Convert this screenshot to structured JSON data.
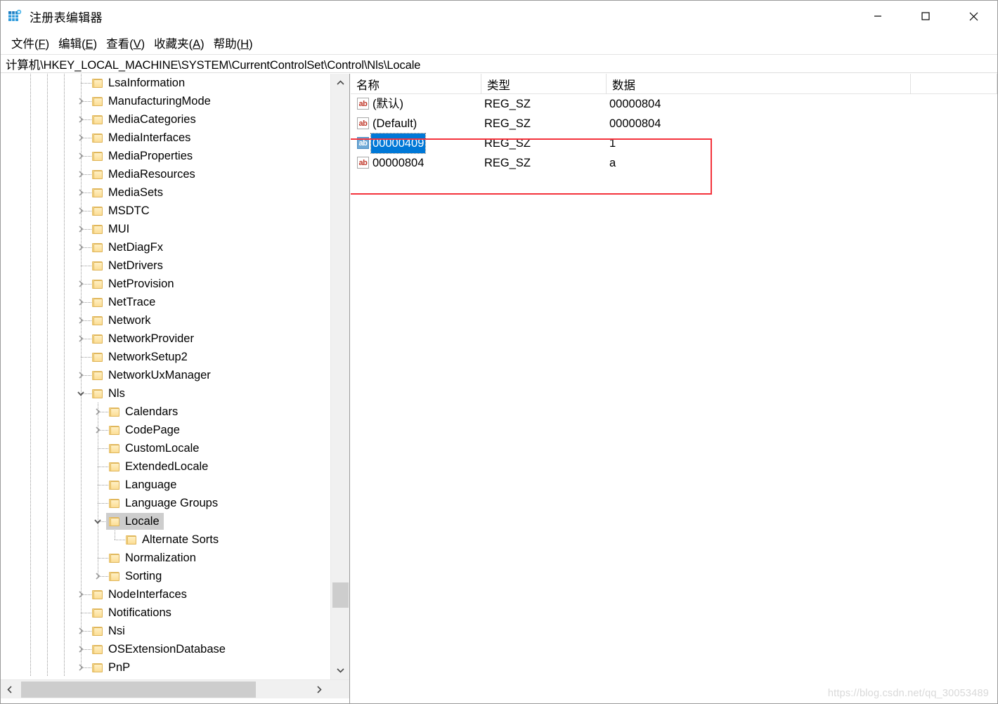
{
  "window": {
    "title": "注册表编辑器",
    "app_icon": "registry-editor-icon",
    "controls": {
      "minimize": "minimize-icon",
      "maximize": "maximize-icon",
      "close": "close-icon"
    }
  },
  "menubar": {
    "items": [
      {
        "label": "文件(F)",
        "accel": "F"
      },
      {
        "label": "编辑(E)",
        "accel": "E"
      },
      {
        "label": "查看(V)",
        "accel": "V"
      },
      {
        "label": "收藏夹(A)",
        "accel": "A"
      },
      {
        "label": "帮助(H)",
        "accel": "H"
      }
    ]
  },
  "address": {
    "path": "计算机\\HKEY_LOCAL_MACHINE\\SYSTEM\\CurrentControlSet\\Control\\Nls\\Locale"
  },
  "tree": {
    "nodes": [
      {
        "label": "LsaInformation",
        "depth": 3,
        "twist": "none",
        "selected": false
      },
      {
        "label": "ManufacturingMode",
        "depth": 3,
        "twist": "collapsed",
        "selected": false
      },
      {
        "label": "MediaCategories",
        "depth": 3,
        "twist": "collapsed",
        "selected": false
      },
      {
        "label": "MediaInterfaces",
        "depth": 3,
        "twist": "collapsed",
        "selected": false
      },
      {
        "label": "MediaProperties",
        "depth": 3,
        "twist": "collapsed",
        "selected": false
      },
      {
        "label": "MediaResources",
        "depth": 3,
        "twist": "collapsed",
        "selected": false
      },
      {
        "label": "MediaSets",
        "depth": 3,
        "twist": "collapsed",
        "selected": false
      },
      {
        "label": "MSDTC",
        "depth": 3,
        "twist": "collapsed",
        "selected": false
      },
      {
        "label": "MUI",
        "depth": 3,
        "twist": "collapsed",
        "selected": false
      },
      {
        "label": "NetDiagFx",
        "depth": 3,
        "twist": "collapsed",
        "selected": false
      },
      {
        "label": "NetDrivers",
        "depth": 3,
        "twist": "none",
        "selected": false
      },
      {
        "label": "NetProvision",
        "depth": 3,
        "twist": "collapsed",
        "selected": false
      },
      {
        "label": "NetTrace",
        "depth": 3,
        "twist": "collapsed",
        "selected": false
      },
      {
        "label": "Network",
        "depth": 3,
        "twist": "collapsed",
        "selected": false
      },
      {
        "label": "NetworkProvider",
        "depth": 3,
        "twist": "collapsed",
        "selected": false
      },
      {
        "label": "NetworkSetup2",
        "depth": 3,
        "twist": "none",
        "selected": false
      },
      {
        "label": "NetworkUxManager",
        "depth": 3,
        "twist": "collapsed",
        "selected": false
      },
      {
        "label": "Nls",
        "depth": 3,
        "twist": "expanded",
        "selected": false
      },
      {
        "label": "Calendars",
        "depth": 4,
        "twist": "collapsed",
        "selected": false
      },
      {
        "label": "CodePage",
        "depth": 4,
        "twist": "collapsed",
        "selected": false
      },
      {
        "label": "CustomLocale",
        "depth": 4,
        "twist": "none",
        "selected": false
      },
      {
        "label": "ExtendedLocale",
        "depth": 4,
        "twist": "none",
        "selected": false
      },
      {
        "label": "Language",
        "depth": 4,
        "twist": "none",
        "selected": false
      },
      {
        "label": "Language Groups",
        "depth": 4,
        "twist": "none",
        "selected": false
      },
      {
        "label": "Locale",
        "depth": 4,
        "twist": "expanded",
        "selected": true
      },
      {
        "label": "Alternate Sorts",
        "depth": 5,
        "twist": "none",
        "selected": false
      },
      {
        "label": "Normalization",
        "depth": 4,
        "twist": "none",
        "selected": false
      },
      {
        "label": "Sorting",
        "depth": 4,
        "twist": "collapsed",
        "selected": false
      },
      {
        "label": "NodeInterfaces",
        "depth": 3,
        "twist": "collapsed",
        "selected": false
      },
      {
        "label": "Notifications",
        "depth": 3,
        "twist": "none",
        "selected": false
      },
      {
        "label": "Nsi",
        "depth": 3,
        "twist": "collapsed",
        "selected": false
      },
      {
        "label": "OSExtensionDatabase",
        "depth": 3,
        "twist": "collapsed",
        "selected": false
      },
      {
        "label": "PnP",
        "depth": 3,
        "twist": "collapsed",
        "selected": false
      }
    ]
  },
  "list": {
    "columns": [
      {
        "label": "名称",
        "key": "name"
      },
      {
        "label": "类型",
        "key": "type"
      },
      {
        "label": "数据",
        "key": "data"
      }
    ],
    "rows": [
      {
        "name": "(默认)",
        "type": "REG_SZ",
        "data": "00000804",
        "icon": "string-value-icon",
        "selected": false
      },
      {
        "name": "(Default)",
        "type": "REG_SZ",
        "data": "00000804",
        "icon": "string-value-icon",
        "selected": false
      },
      {
        "name": "00000409",
        "type": "REG_SZ",
        "data": "1",
        "icon": "string-value-icon",
        "selected": true
      },
      {
        "name": "00000804",
        "type": "REG_SZ",
        "data": "a",
        "icon": "string-value-icon",
        "selected": false
      }
    ]
  },
  "annotation": {
    "color": "#f4333c"
  },
  "watermark": {
    "text": "https://blog.csdn.net/qq_30053489"
  }
}
